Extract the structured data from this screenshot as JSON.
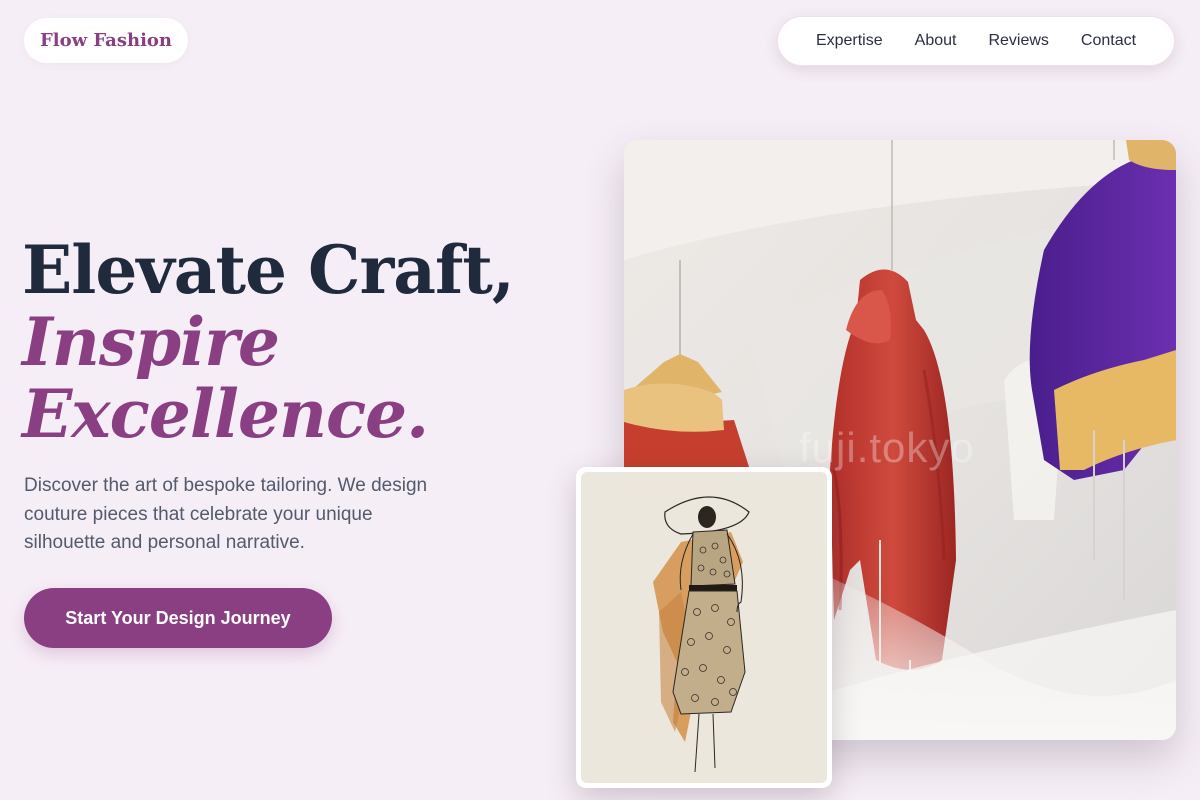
{
  "brand": {
    "name": "Flow Fashion"
  },
  "nav": {
    "items": [
      {
        "label": "Expertise"
      },
      {
        "label": "About"
      },
      {
        "label": "Reviews"
      },
      {
        "label": "Contact"
      }
    ]
  },
  "hero": {
    "title_line1": "Elevate Craft,",
    "title_line2": "Inspire",
    "title_line3": "Excellence.",
    "description": "Discover the art of bespoke tailoring. We design couture pieces that celebrate your unique silhouette and personal narrative.",
    "cta_label": "Start Your Design Journey"
  },
  "images": {
    "main_watermark": "fuji.tokyo"
  },
  "colors": {
    "background": "#f6eef6",
    "accent": "#8a3f82",
    "heading": "#1f2a3d",
    "body_text": "#525a6c"
  }
}
